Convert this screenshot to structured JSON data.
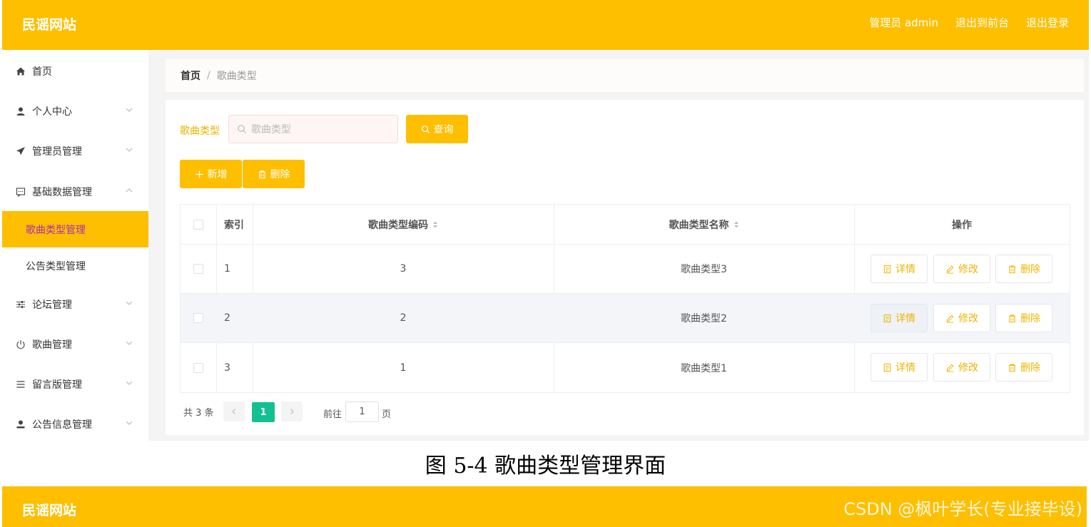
{
  "header": {
    "brand": "民谣网站",
    "admin_label": "管理员 admin",
    "to_front": "退出到前台",
    "logout": "退出登录"
  },
  "sidebar": {
    "items": [
      {
        "label": "首页",
        "icon": "home-icon"
      },
      {
        "label": "个人中心",
        "icon": "user-icon"
      },
      {
        "label": "管理员管理",
        "icon": "send-icon"
      },
      {
        "label": "基础数据管理",
        "icon": "chat-icon"
      },
      {
        "label": "歌曲类型管理"
      },
      {
        "label": "公告类型管理"
      },
      {
        "label": "论坛管理",
        "icon": "sliders-icon"
      },
      {
        "label": "歌曲管理",
        "icon": "power-icon"
      },
      {
        "label": "留言版管理",
        "icon": "list-icon"
      },
      {
        "label": "公告信息管理",
        "icon": "person-icon"
      }
    ]
  },
  "breadcrumb": {
    "home": "首页",
    "sep": "/",
    "current": "歌曲类型"
  },
  "filter": {
    "label": "歌曲类型",
    "placeholder": "歌曲类型",
    "query_button": "查询"
  },
  "actions": {
    "add": "新增",
    "delete": "删除"
  },
  "table": {
    "headers": {
      "index": "索引",
      "code": "歌曲类型编码",
      "name": "歌曲类型名称",
      "ops": "操作"
    },
    "rows": [
      {
        "index": "1",
        "code": "3",
        "name": "歌曲类型3"
      },
      {
        "index": "2",
        "code": "2",
        "name": "歌曲类型2"
      },
      {
        "index": "3",
        "code": "1",
        "name": "歌曲类型1"
      }
    ],
    "op_labels": {
      "detail": "详情",
      "edit": "修改",
      "delete": "删除"
    }
  },
  "pagination": {
    "total": "共 3 条",
    "current_page": "1",
    "goto_prefix": "前往",
    "goto_value": "1",
    "goto_suffix": "页"
  },
  "caption": "图 5-4 歌曲类型管理界面",
  "second_header": {
    "brand": "民谣网站"
  },
  "watermark": "CSDN @枫叶学长(专业接毕设)",
  "colors": {
    "accent": "#fdbf00",
    "active_text": "#b02bb0",
    "page_active": "#13c090",
    "op_text": "#f0b400"
  }
}
